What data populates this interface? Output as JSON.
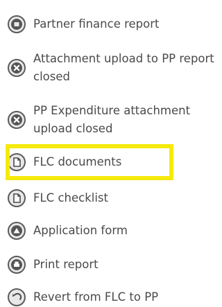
{
  "menu": {
    "items": [
      {
        "label": "Partner finance report",
        "icon": "square-circle-icon"
      },
      {
        "label": "Attachment upload to PP report closed",
        "icon": "close-circle-icon"
      },
      {
        "label": "PP Expenditure attachment upload closed",
        "icon": "close-circle-icon"
      },
      {
        "label": "FLC documents",
        "icon": "document-circle-icon"
      },
      {
        "label": "FLC checklist",
        "icon": "document-circle-icon"
      },
      {
        "label": "Application form",
        "icon": "application-circle-icon"
      },
      {
        "label": "Print report",
        "icon": "printer-circle-icon"
      },
      {
        "label": "Revert from FLC to PP",
        "icon": "revert-circle-icon"
      }
    ]
  },
  "colors": {
    "text": "#4a4a4a",
    "icon_border": "#5a5a5a",
    "icon_fill": "#e8e8e8",
    "highlight": "#f5ea0b"
  }
}
